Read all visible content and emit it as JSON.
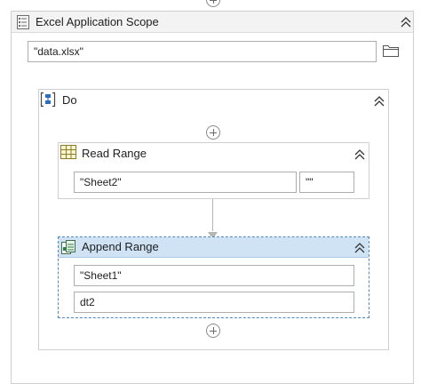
{
  "scope": {
    "title": "Excel Application Scope",
    "workbook_path": "\"data.xlsx\""
  },
  "do": {
    "title": "Do"
  },
  "read_range": {
    "title": "Read Range",
    "sheet": "\"Sheet2\"",
    "range": "\"\""
  },
  "append_range": {
    "title": "Append Range",
    "sheet": "\"Sheet1\"",
    "datatable": "dt2"
  },
  "icons": {
    "scope": "excel-scope-icon",
    "do": "sequence-icon",
    "read": "read-range-icon",
    "append": "append-range-icon",
    "folder": "folder-icon",
    "collapse": "double-chevron-up-icon",
    "add": "add-activity-icon"
  },
  "colors": {
    "selected_header": "#cfe3f5",
    "selected_border": "#4d88c4"
  }
}
